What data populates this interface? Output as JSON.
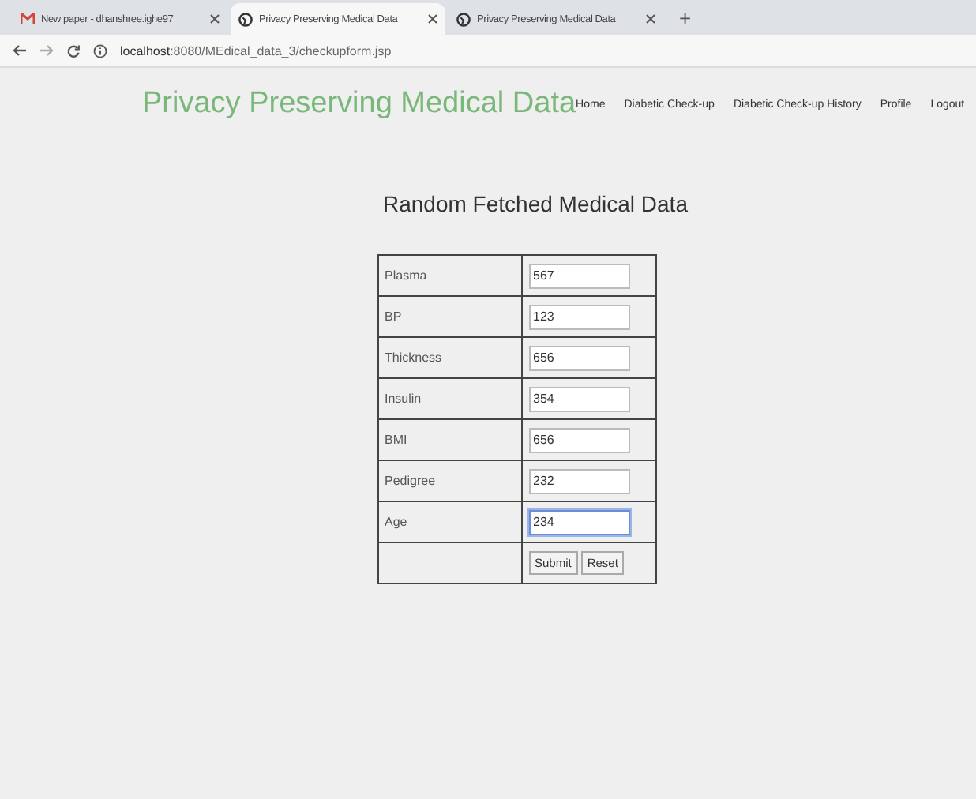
{
  "browser": {
    "tabs": [
      {
        "kind": "gmail",
        "title": "New paper - dhanshree.ighe97",
        "selected": false
      },
      {
        "kind": "globe",
        "title": "Privacy Preserving Medical Data",
        "selected": true
      },
      {
        "kind": "globe",
        "title": "Privacy Preserving Medical Data",
        "selected": false
      }
    ],
    "new_tab": "+",
    "url_host": "localhost",
    "url_rest": ":8080/MEdical_data_3/checkupform.jsp"
  },
  "site": {
    "title": "Privacy Preserving Medical Data",
    "nav": [
      "Home",
      "Diabetic Check-up",
      "Diabetic Check-up History",
      "Profile",
      "Logout"
    ]
  },
  "heading": "Random Fetched Medical Data",
  "form": {
    "fields": [
      {
        "label": "Plasma",
        "value": "567",
        "focused": false
      },
      {
        "label": "BP",
        "value": "123",
        "focused": false
      },
      {
        "label": "Thickness",
        "value": "656",
        "focused": false
      },
      {
        "label": "Insulin",
        "value": "354",
        "focused": false
      },
      {
        "label": "BMI",
        "value": "656",
        "focused": false
      },
      {
        "label": "Pedigree",
        "value": "232",
        "focused": false
      },
      {
        "label": "Age",
        "value": "234",
        "focused": true
      }
    ],
    "buttons": [
      "Submit",
      "Reset"
    ]
  }
}
